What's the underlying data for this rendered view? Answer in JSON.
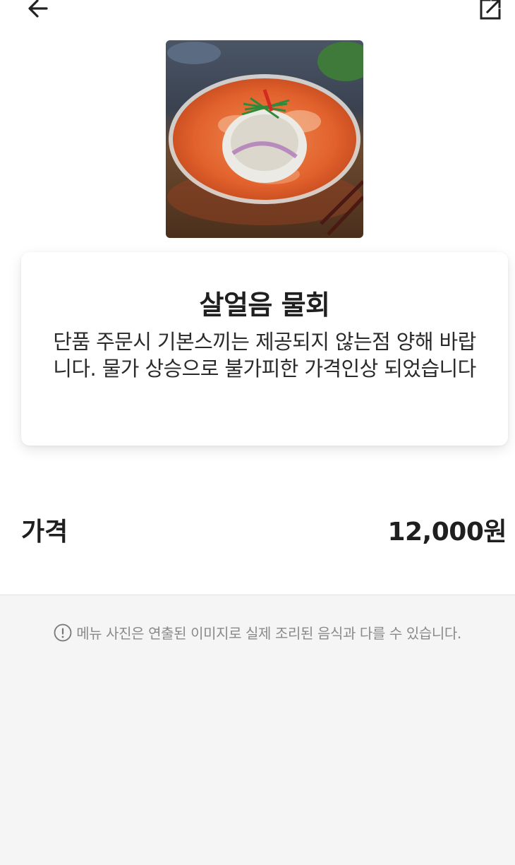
{
  "header": {
    "back_icon": "arrow-left-icon",
    "share_icon": "share-icon"
  },
  "menu": {
    "name": "살얼음 물회",
    "description": "단품 주문시 기본스끼는 제공되지 않는점 양해 바랍니다. 물가 상승으로 불가피한 가격인상 되었습니다",
    "photo_icon": "food-photo"
  },
  "price": {
    "label": "가격",
    "value": "12,000원"
  },
  "notice": {
    "icon": "info-icon",
    "text": "메뉴 사진은 연출된 이미지로 실제 조리된 음식과 다를 수 있습니다."
  }
}
